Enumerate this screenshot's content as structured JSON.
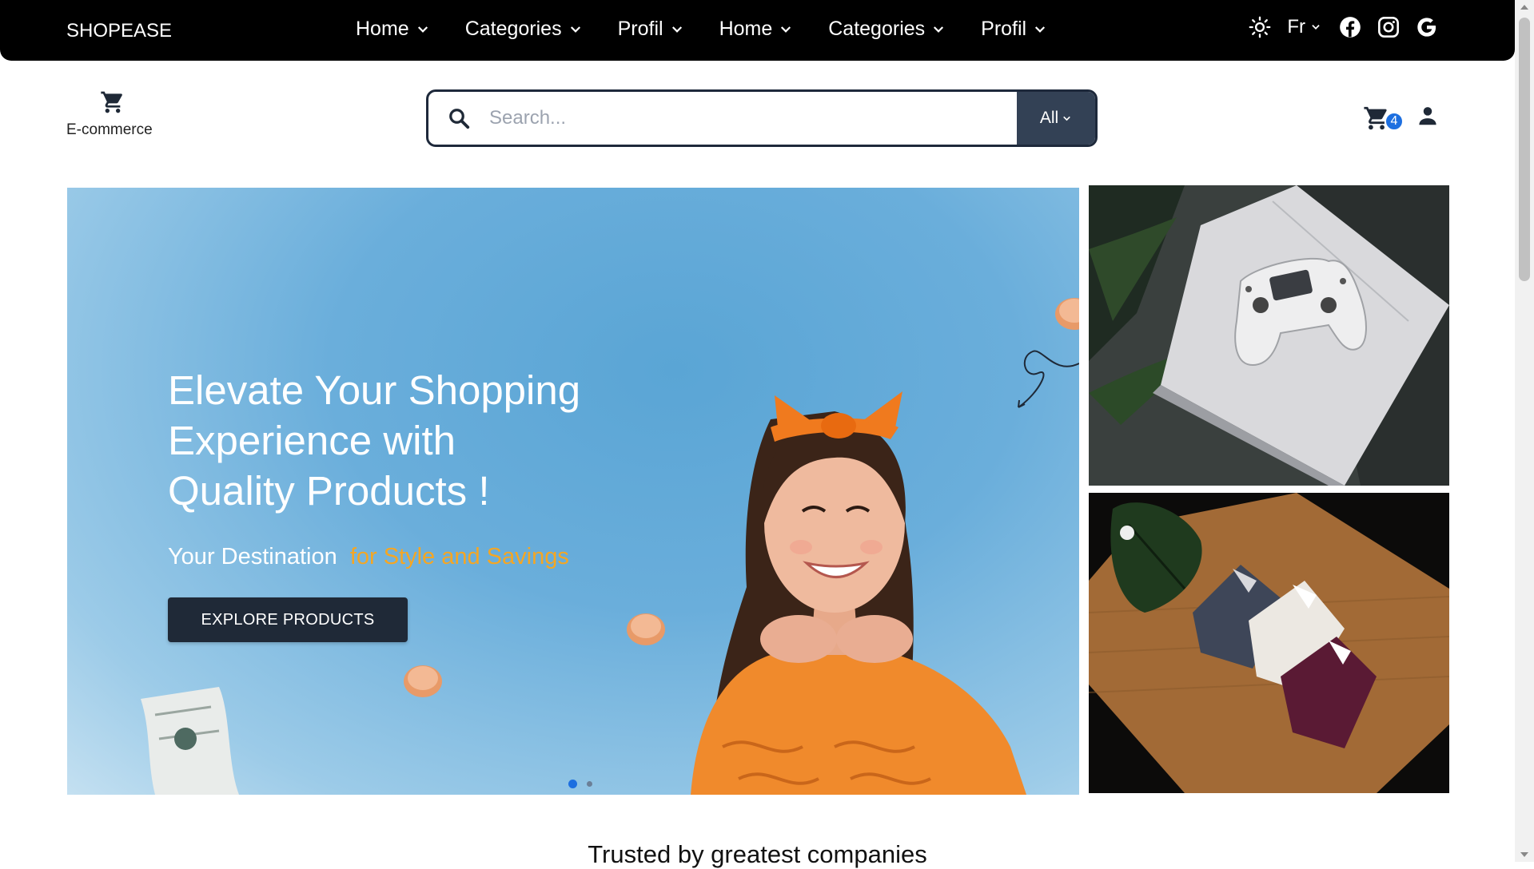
{
  "topbar": {
    "brand": "SHOPEASE",
    "nav": [
      {
        "label": "Home",
        "icon": "chevron-down-icon"
      },
      {
        "label": "Categories",
        "icon": "chevron-down-icon"
      },
      {
        "label": "Profil",
        "icon": "chevron-down-icon"
      },
      {
        "label": "Home",
        "icon": "chevron-down-icon"
      },
      {
        "label": "Categories",
        "icon": "chevron-down-icon"
      },
      {
        "label": "Profil",
        "icon": "chevron-down-icon"
      }
    ],
    "language": "Fr",
    "icons": [
      "sun-icon",
      "facebook-icon",
      "instagram-icon",
      "google-icon"
    ]
  },
  "header": {
    "logo_text": "E-commerce",
    "search": {
      "placeholder": "Search...",
      "value": "",
      "category": "All"
    },
    "cart_count": "4"
  },
  "hero": {
    "title_lines": [
      "Elevate Your Shopping",
      "Experience with",
      "Quality Products !"
    ],
    "subtitle": "Your Destination",
    "subtitle_accent": "for Style and Savings",
    "button": "EXPLORE PRODUCTS",
    "slide_count": 2,
    "active_slide": 1,
    "colors": {
      "accent": "#f5a623",
      "button": "#1f2937",
      "background": "#5aa5d5"
    }
  },
  "side_banners": [
    {
      "subject": "game-controller-on-console"
    },
    {
      "subject": "folded-shirts-on-wooden-board"
    }
  ],
  "sections": {
    "trusted_title": "Trusted by greatest companies"
  }
}
